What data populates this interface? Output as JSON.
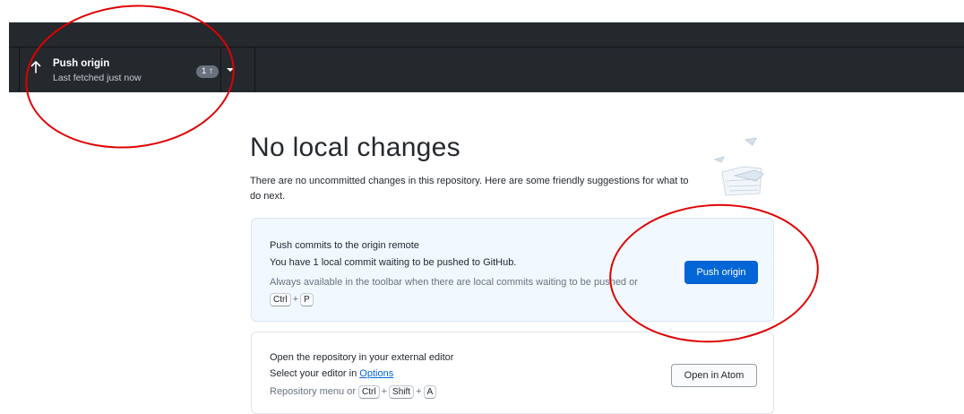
{
  "toolbar": {
    "push_title": "Push origin",
    "push_subtitle": "Last fetched just now",
    "ahead_count": "1",
    "ahead_arrow": "↑"
  },
  "main": {
    "heading": "No local changes",
    "description": "There are no uncommitted changes in this repository. Here are some friendly suggestions for what to do next."
  },
  "push_card": {
    "title": "Push commits to the origin remote",
    "text": "You have 1 local commit waiting to be pushed to GitHub.",
    "hint": "Always available in the toolbar when there are local commits waiting to be pushed or",
    "shortcut_ctrl": "Ctrl",
    "shortcut_plus": "+",
    "shortcut_key": "P",
    "button_label": "Push origin"
  },
  "editor_card": {
    "title": "Open the repository in your external editor",
    "text_prefix": "Select your editor in ",
    "options_link": "Options",
    "hint_prefix": "Repository menu or ",
    "shortcut_ctrl": "Ctrl",
    "shortcut_plus": "+",
    "shortcut_shift": "Shift",
    "shortcut_key": "A",
    "button_label": "Open in Atom"
  },
  "colors": {
    "toolbar_bg": "#24292e",
    "primary_button": "#0366d6",
    "annotation": "#e00000"
  },
  "icons": {
    "push": "arrow-up-icon",
    "dropdown": "caret-down-icon",
    "illustration": "paper-boats-illustration"
  }
}
